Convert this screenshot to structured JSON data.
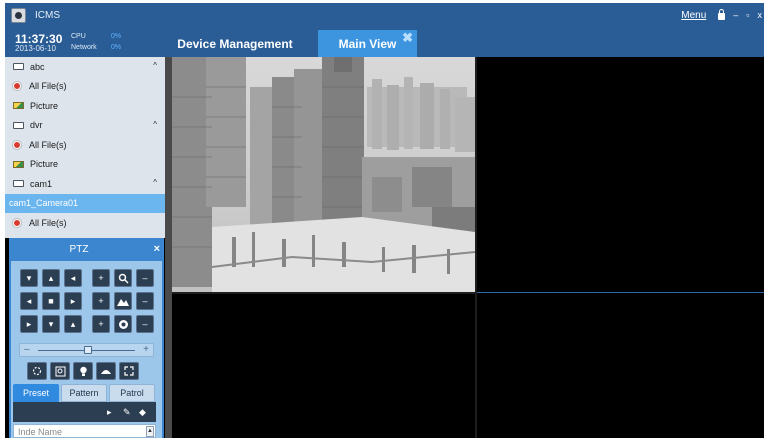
{
  "app": {
    "title": "ICMS"
  },
  "window_controls": {
    "menu_label": "Menu",
    "minimize": "–",
    "restore": "▫",
    "close": "x"
  },
  "header": {
    "time": "11:37:30",
    "date": "2013-06-10",
    "cpu_label": "CPU",
    "cpu_value": "0%",
    "network_label": "Network",
    "network_value": "0%"
  },
  "tabs": [
    {
      "label": "Device Management",
      "active": false
    },
    {
      "label": "Main View",
      "active": true
    }
  ],
  "sidebar": {
    "items": [
      {
        "label": "abc",
        "type": "device",
        "collapse": "^"
      },
      {
        "label": "All File(s)",
        "type": "record"
      },
      {
        "label": "Picture",
        "type": "picture"
      },
      {
        "label": "dvr",
        "type": "device",
        "collapse": "^"
      },
      {
        "label": "All File(s)",
        "type": "record"
      },
      {
        "label": "Picture",
        "type": "picture"
      },
      {
        "label": "cam1",
        "type": "device",
        "collapse": "^"
      },
      {
        "label": "cam1_Camera01",
        "type": "channel",
        "selected": true
      },
      {
        "label": "All File(s)",
        "type": "record"
      }
    ]
  },
  "ptz": {
    "title": "PTZ",
    "close": "×",
    "slider": {
      "minus": "–",
      "plus": "+"
    },
    "tabs": [
      {
        "label": "Preset",
        "active": true
      },
      {
        "label": "Pattern",
        "active": false
      },
      {
        "label": "Patrol",
        "active": false
      }
    ],
    "list_header": "Inde Name",
    "scroll_arrow": "▲",
    "preset_controls": {
      "play": "▸",
      "edit": "✎",
      "delete": "◆"
    }
  },
  "video": {
    "active_cell": 1,
    "cells": 4
  },
  "colors": {
    "title_bar": "#2a5d96",
    "active_tab": "#3d95e0",
    "sidebar_bg": "#dde4ec",
    "selected_row": "#6cb6ef",
    "ptz_header": "#3b86cf",
    "ptz_body": "#9cc6ea"
  }
}
